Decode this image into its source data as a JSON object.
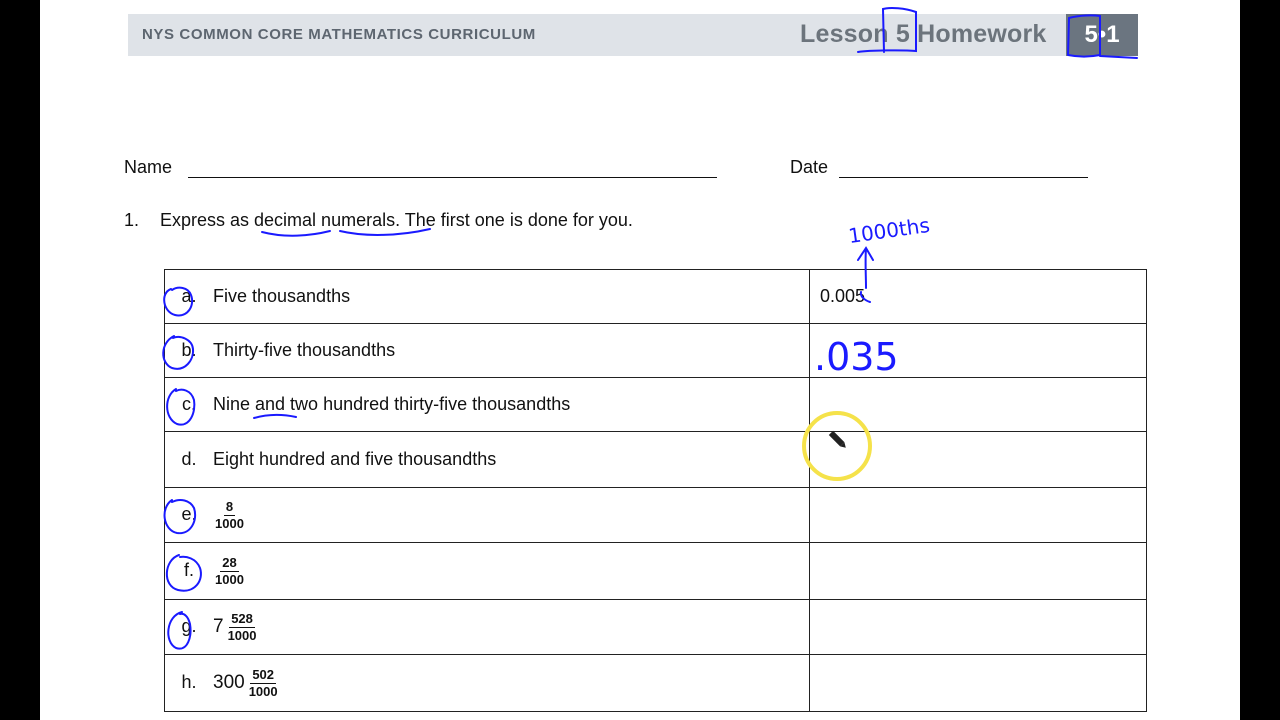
{
  "header": {
    "curriculum": "NYS COMMON CORE MATHEMATICS CURRICULUM",
    "lesson": "Lesson 5 Homework",
    "module": "5•1"
  },
  "form": {
    "name_label": "Name",
    "date_label": "Date"
  },
  "problem": {
    "number": "1.",
    "text": "Express as decimal numerals.  The first one is done for you."
  },
  "rows": [
    {
      "label": "a.",
      "text": "Five thousandths",
      "answer": "0.005"
    },
    {
      "label": "b.",
      "text": "Thirty-five thousandths",
      "answer": ""
    },
    {
      "label": "c.",
      "text": "Nine and two hundred thirty-five thousandths",
      "answer": ""
    },
    {
      "label": "d.",
      "text": "Eight hundred and five thousandths",
      "answer": ""
    },
    {
      "label": "e.",
      "numerator": "8",
      "denominator": "1000",
      "answer": ""
    },
    {
      "label": "f.",
      "numerator": "28",
      "denominator": "1000",
      "answer": ""
    },
    {
      "label": "g.",
      "whole": "7",
      "numerator": "528",
      "denominator": "1000",
      "answer": ""
    },
    {
      "label": "h.",
      "whole": "300",
      "numerator": "502",
      "denominator": "1000",
      "answer": ""
    }
  ],
  "annotations": {
    "ink_color": "#1a1aff",
    "cursor_highlight_color": "#f5e24a",
    "handwritten_answer_b": ".035",
    "handwritten_note": "1000ths"
  }
}
